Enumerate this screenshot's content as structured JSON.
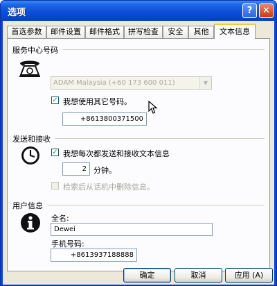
{
  "window": {
    "title": "选项",
    "help_glyph": "?",
    "close_glyph": "✕"
  },
  "tabs": [
    {
      "label": "首选参数"
    },
    {
      "label": "邮件设置"
    },
    {
      "label": "邮件格式"
    },
    {
      "label": "拼写检查"
    },
    {
      "label": "安全"
    },
    {
      "label": "其他"
    },
    {
      "label": "文本信息",
      "active": true
    }
  ],
  "service_center": {
    "heading": "服务中心号码",
    "combo_value": "ADAM Malaysia (+60 173 600 011)",
    "use_other_label": "我想使用其它号码。",
    "use_other_checked": true,
    "other_number": "+8613800371500"
  },
  "send_receive": {
    "heading": "发送和接收",
    "check_label": "我想每次都发送和接收文本信息",
    "checked": true,
    "interval_value": "2",
    "interval_unit": "分钟。",
    "delete_label": "检索后从话机中删除信息。",
    "delete_checked": false
  },
  "user_info": {
    "heading": "用户信息",
    "name_label": "全名:",
    "name_value": "Dewei",
    "phone_label": "手机号码:",
    "phone_value": "+8613937188888"
  },
  "buttons": {
    "ok": "确定",
    "cancel": "取消",
    "apply": "应用 (A)"
  },
  "icons": [
    "phone-icon",
    "clock-icon",
    "info-icon",
    "cursor-icon"
  ]
}
